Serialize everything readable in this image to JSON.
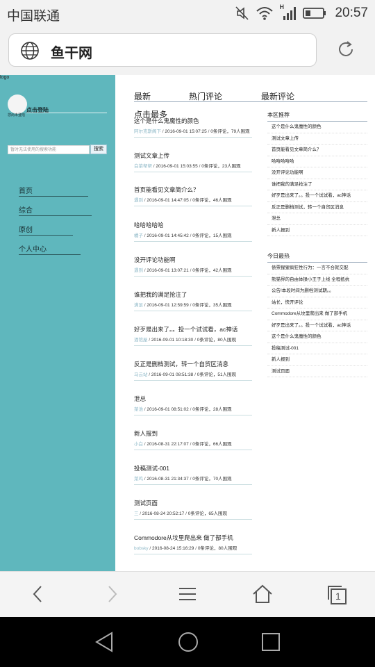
{
  "status_bar": {
    "carrier": "中国联通",
    "signal_type": "H",
    "time": "20:57"
  },
  "address_bar": {
    "title": "鱼干网"
  },
  "sidebar": {
    "logo": "logo",
    "login_link": "点击登陆",
    "login_note": "您尚未登陆",
    "search_placeholder": "暂时无法使用的搜索功能",
    "search_button": "搜索",
    "nav": [
      "首页",
      "综合",
      "原创",
      "个人中心"
    ]
  },
  "tabs": [
    "最新",
    "热门评论",
    "最新评论"
  ],
  "click_most": "点击最多",
  "articles": [
    {
      "title": "这个是什么鬼魔性的颜色",
      "author": "阿尔克斯阁下",
      "date": "2016-09-01 15:07:25",
      "comments": "0条评论，",
      "views": "79人围观"
    },
    {
      "title": "测试文章上传",
      "author": "白菜帮帮",
      "date": "2016-09-01 15:03:55",
      "comments": "0条评论，",
      "views": "23人围观"
    },
    {
      "title": "首页能看见文章简介么？",
      "author": "遇到",
      "date": "2016-09-01 14:47:05",
      "comments": "0条评论，",
      "views": "46人围观"
    },
    {
      "title": "哈哈哈哈哈",
      "author": "橘子",
      "date": "2016-09-01 14:45:42",
      "comments": "0条评论，",
      "views": "15人围观"
    },
    {
      "title": "没开评论功能啊",
      "author": "遇到",
      "date": "2016-09-01 13:07:21",
      "comments": "0条评论，",
      "views": "42人围观"
    },
    {
      "title": "谁把我的满足抢注了",
      "author": "满足",
      "date": "2016-09-01 12:59:59",
      "comments": "0条评论，",
      "views": "35人围观"
    },
    {
      "title": "好歹是出来了。。投一个试试看，ac神话",
      "author": "酒馆屋",
      "date": "2016-09-01 10:18:30",
      "comments": "0条评论，",
      "views": "80人围观"
    },
    {
      "title": "反正是删档测试，转一个自贸区消息",
      "author": "马云站",
      "date": "2016-09-01 08:51:38",
      "comments": "0条评论，",
      "views": "51人围观"
    },
    {
      "title": "泄总",
      "author": "菜池",
      "date": "2016-09-01 08:51:02",
      "comments": "0条评论，",
      "views": "28人围观"
    },
    {
      "title": "新人报到",
      "author": "小白",
      "date": "2016-08-31 22:17:07",
      "comments": "0条评论，",
      "views": "66人围观"
    },
    {
      "title": "投稿测试-001",
      "author": "菜鸡",
      "date": "2016-08-31 21:34:37",
      "comments": "0条评论，",
      "views": "70人围观"
    },
    {
      "title": "测试页面",
      "author": "三",
      "date": "2016-08-24 20:52:17",
      "comments": "0条评论，",
      "views": "65人围观"
    },
    {
      "title": "Commodore从坟里爬出来 做了部手机",
      "author": "bobsky",
      "date": "2016-08-24 15:16:29",
      "comments": "0条评论，",
      "views": "80人围观"
    }
  ],
  "recommend": {
    "heading": "本区推荐",
    "items": [
      "这个是什么鬼魔性的颜色",
      "测试文章上传",
      "首页能看见文章简介么？",
      "哈哈哈哈哈",
      "没开评论功能啊",
      "谁把我的满足抢注了",
      "好歹是出来了。。投一个试试看，ac神话",
      "反正是删档测试，转一个自贸区消息",
      "泄总",
      "新人报到"
    ]
  },
  "hot_today": {
    "heading": "今日最热",
    "items": [
      "债票猩猩疯狂性行为：一言不合就交配",
      "熊猫界的自由体操小王子上线 全程抵抗",
      "公告!本段时间为删档测试期。。",
      "站长，快开评论",
      "Commodore从坟里爬出来 做了部手机",
      "好歹是出来了。。投一个试试看，ac神话",
      "这个是什么鬼魔性的颜色",
      "投稿测试-001",
      "新人报到",
      "测试页面"
    ]
  },
  "bottom_bar": {
    "tab_count": "1"
  }
}
